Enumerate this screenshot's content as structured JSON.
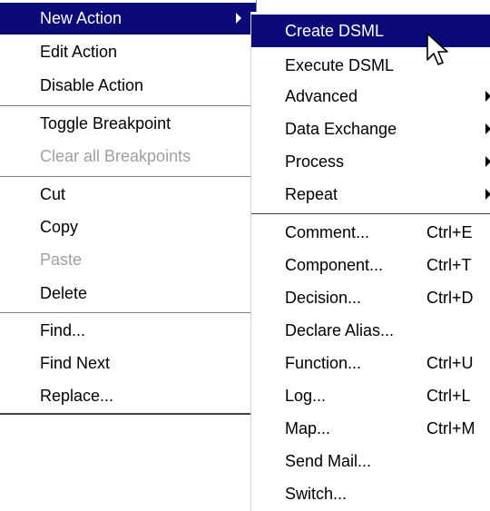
{
  "main_menu": {
    "items": [
      {
        "label": "New Action",
        "state": "highlighted",
        "submenu": true
      },
      {
        "label": "Edit Action",
        "state": "enabled"
      },
      {
        "label": "Disable Action",
        "state": "enabled"
      },
      {
        "label": "Toggle Breakpoint",
        "state": "enabled"
      },
      {
        "label": "Clear all Breakpoints",
        "state": "disabled"
      },
      {
        "label": "Cut",
        "state": "enabled"
      },
      {
        "label": "Copy",
        "state": "enabled"
      },
      {
        "label": "Paste",
        "state": "disabled"
      },
      {
        "label": "Delete",
        "state": "enabled"
      },
      {
        "label": "Find...",
        "state": "enabled"
      },
      {
        "label": "Find Next",
        "state": "enabled"
      },
      {
        "label": "Replace...",
        "state": "enabled"
      }
    ]
  },
  "sub_menu": {
    "items": [
      {
        "label": "Create DSML",
        "state": "highlighted"
      },
      {
        "label": "Execute DSML",
        "state": "enabled"
      },
      {
        "label": "Advanced",
        "state": "enabled",
        "submenu": true
      },
      {
        "label": "Data Exchange",
        "state": "enabled",
        "submenu": true
      },
      {
        "label": "Process",
        "state": "enabled",
        "submenu": true
      },
      {
        "label": "Repeat",
        "state": "enabled",
        "submenu": true
      },
      {
        "label": "Comment...",
        "shortcut": "Ctrl+E"
      },
      {
        "label": "Component...",
        "shortcut": "Ctrl+T"
      },
      {
        "label": "Decision...",
        "shortcut": "Ctrl+D"
      },
      {
        "label": "Declare Alias..."
      },
      {
        "label": "Function...",
        "shortcut": "Ctrl+U"
      },
      {
        "label": "Log...",
        "shortcut": "Ctrl+L"
      },
      {
        "label": "Map...",
        "shortcut": "Ctrl+M"
      },
      {
        "label": "Send Mail..."
      },
      {
        "label": "Switch..."
      }
    ]
  },
  "colors": {
    "highlight": "#0a0a78",
    "disabled_text": "#a0a0a0"
  },
  "icons": {
    "cursor": "mouse-pointer-icon",
    "submenu_arrow": "chevron-right-icon"
  }
}
